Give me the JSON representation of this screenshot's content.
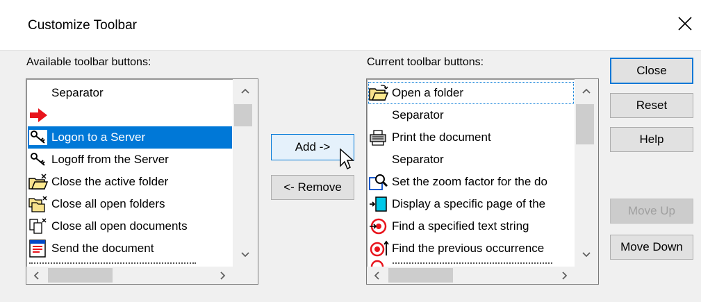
{
  "window": {
    "title": "Customize Toolbar"
  },
  "available": {
    "label": "Available toolbar buttons:",
    "items": [
      {
        "label": "Separator",
        "icon": "none"
      },
      {
        "label": "",
        "icon": "red-arrow-icon"
      },
      {
        "label": "Logon to a Server",
        "icon": "keys-icon",
        "selected": true
      },
      {
        "label": "Logoff from the Server",
        "icon": "keys-icon"
      },
      {
        "label": "Close the active folder",
        "icon": "folder-close-icon"
      },
      {
        "label": "Close all open folders",
        "icon": "folders-close-icon"
      },
      {
        "label": "Close all open documents",
        "icon": "documents-close-icon"
      },
      {
        "label": "Send the document",
        "icon": "send-document-icon"
      }
    ]
  },
  "current": {
    "label": "Current toolbar buttons:",
    "items": [
      {
        "label": "Open a folder",
        "icon": "open-folder-icon",
        "focused": true
      },
      {
        "label": "Separator",
        "icon": "none"
      },
      {
        "label": "Print the document",
        "icon": "printer-icon"
      },
      {
        "label": "Separator",
        "icon": "none"
      },
      {
        "label": "Set the zoom factor for the do",
        "icon": "zoom-icon"
      },
      {
        "label": "Display a specific page of the",
        "icon": "page-icon"
      },
      {
        "label": "Find a specified text string",
        "icon": "find-icon"
      },
      {
        "label": "Find the previous occurrence",
        "icon": "find-previous-icon"
      }
    ]
  },
  "buttons": {
    "add": "Add ->",
    "remove": "<- Remove",
    "close": "Close",
    "reset": "Reset",
    "help": "Help",
    "move_up": "Move Up",
    "move_down": "Move Down"
  },
  "colors": {
    "selection": "#0078d7",
    "dialog_bg": "#f0f0f0",
    "disabled_text": "#a0a0a0"
  }
}
